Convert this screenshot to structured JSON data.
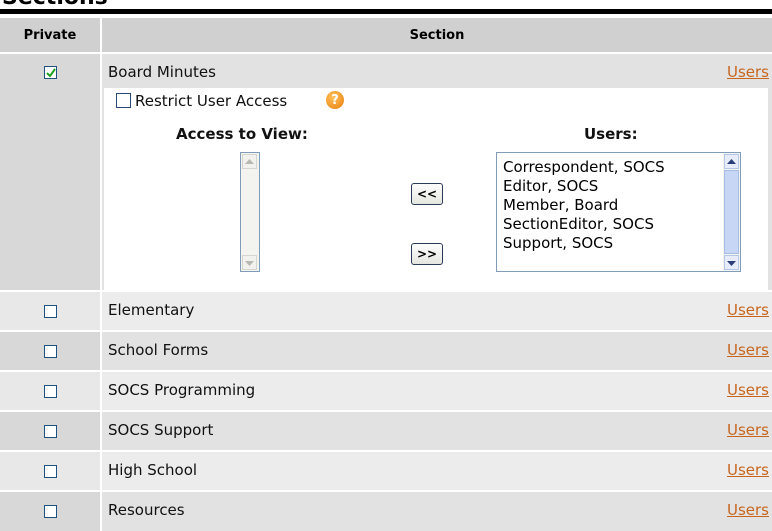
{
  "page": {
    "title": "Sections"
  },
  "table": {
    "col_private": "Private",
    "col_section": "Section",
    "users_link_label": "Users",
    "rows": [
      {
        "label": "Board Minutes",
        "private": true
      },
      {
        "label": "Elementary",
        "private": false
      },
      {
        "label": "School Forms",
        "private": false
      },
      {
        "label": "SOCS Programming",
        "private": false
      },
      {
        "label": "SOCS Support",
        "private": false
      },
      {
        "label": "High School",
        "private": false
      },
      {
        "label": "Resources",
        "private": false
      }
    ]
  },
  "access_panel": {
    "restrict_label": "Restrict User Access",
    "restrict_checked": false,
    "help_icon": "help-icon",
    "access_to_view_label": "Access to View:",
    "users_label": "Users:",
    "access_to_view_items": [],
    "users_items": [
      "Correspondent, SOCS",
      "Editor, SOCS",
      "Member, Board",
      "SectionEditor, SOCS",
      "Support, SOCS"
    ],
    "add_button": "<<",
    "remove_button": ">>"
  },
  "colors": {
    "header_bg": "#d0d0d0",
    "row_bg_dark": "#e2e2e2",
    "row_bg_light": "#ececec",
    "link": "#c8661f",
    "help": "#f39a1e"
  }
}
